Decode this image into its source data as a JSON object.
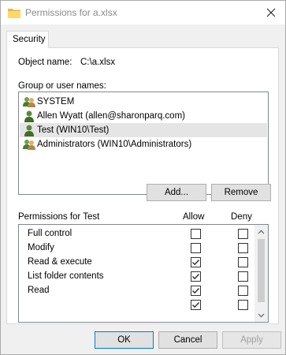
{
  "window": {
    "title": "Permissions for a.xlsx",
    "icon": "folder-icon"
  },
  "tabs": [
    {
      "label": "Security",
      "active": true
    }
  ],
  "object": {
    "label": "Object name:",
    "value": "C:\\a.xlsx"
  },
  "groups": {
    "label": "Group or user names:",
    "items": [
      {
        "name": "SYSTEM",
        "icon": "group-users-icon",
        "selected": false
      },
      {
        "name": "Allen Wyatt (allen@sharonparq.com)",
        "icon": "user-icon",
        "selected": false
      },
      {
        "name": "Test (WIN10\\Test)",
        "icon": "user-icon",
        "selected": true
      },
      {
        "name": "Administrators (WIN10\\Administrators)",
        "icon": "group-users-icon",
        "selected": false
      }
    ],
    "add_label": "Add...",
    "remove_label": "Remove"
  },
  "permissions": {
    "label": "Permissions for Test",
    "allow_label": "Allow",
    "deny_label": "Deny",
    "rows": [
      {
        "name": "Full control",
        "allow": false,
        "deny": false
      },
      {
        "name": "Modify",
        "allow": false,
        "deny": false
      },
      {
        "name": "Read & execute",
        "allow": true,
        "deny": false
      },
      {
        "name": "List folder contents",
        "allow": true,
        "deny": false
      },
      {
        "name": "Read",
        "allow": true,
        "deny": false
      }
    ]
  },
  "footer": {
    "ok_label": "OK",
    "cancel_label": "Cancel",
    "apply_label": "Apply",
    "apply_enabled": false
  },
  "colors": {
    "selection": "#e5e5e5",
    "focus_border": "#0078d7"
  }
}
